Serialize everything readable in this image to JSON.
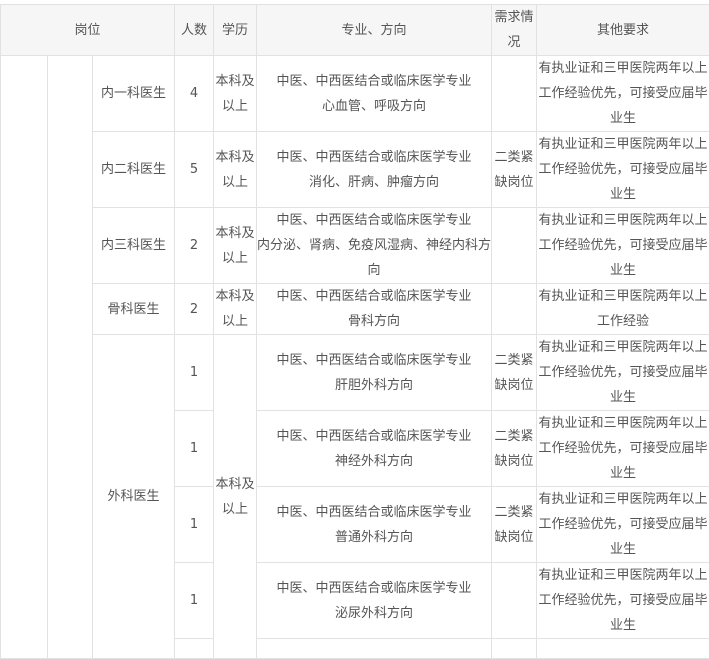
{
  "header": {
    "post": "岗位",
    "count": "人数",
    "education": "学历",
    "major": "专业、方向",
    "demand": "需求情况",
    "other": "其他要求"
  },
  "rows": [
    {
      "post": "内一科医生",
      "count": "4",
      "education": "本科及以上",
      "major_l1": "中医、中西医结合或临床医学专业",
      "major_l2": "心血管、呼吸方向",
      "demand": "",
      "other": "有执业证和三甲医院两年以上工作经验优先，可接受应届毕业生"
    },
    {
      "post": "内二科医生",
      "count": "5",
      "education": "本科及以上",
      "major_l1": "中医、中西医结合或临床医学专业",
      "major_l2": "消化、肝病、肿瘤方向",
      "demand": "二类紧缺岗位",
      "other": "有执业证和三甲医院两年以上工作经验优先，可接受应届毕业生"
    },
    {
      "post": "内三科医生",
      "count": "2",
      "education": "本科及以上",
      "major_l1": "中医、中西医结合或临床医学专业",
      "major_l2": "内分泌、肾病、免疫风湿病、神经内科方向",
      "demand": "",
      "other": "有执业证和三甲医院两年以上工作经验优先，可接受应届毕业生"
    },
    {
      "post": "骨科医生",
      "count": "2",
      "education": "本科及以上",
      "major_l1": "中医、中西医结合或临床医学专业",
      "major_l2": "骨科方向",
      "demand": "",
      "other": "有执业证和三甲医院两年以上工作经验"
    }
  ],
  "surgery": {
    "post": "外科医生",
    "education": "本科及以上",
    "rows": [
      {
        "count": "1",
        "major_l1": "中医、中西医结合或临床医学专业",
        "major_l2": "肝胆外科方向",
        "demand": "二类紧缺岗位",
        "other": "有执业证和三甲医院两年以上工作经验优先，可接受应届毕业生"
      },
      {
        "count": "1",
        "major_l1": "中医、中西医结合或临床医学专业",
        "major_l2": "神经外科方向",
        "demand": "二类紧缺岗位",
        "other": "有执业证和三甲医院两年以上工作经验优先，可接受应届毕业生"
      },
      {
        "count": "1",
        "major_l1": "中医、中西医结合或临床医学专业",
        "major_l2": "普通外科方向",
        "demand": "二类紧缺岗位",
        "other": "有执业证和三甲医院两年以上工作经验优先，可接受应届毕业生"
      },
      {
        "count": "1",
        "major_l1": "中医、中西医结合或临床医学专业",
        "major_l2": "泌尿外科方向",
        "demand": "",
        "other": "有执业证和三甲医院两年以上工作经验优先，可接受应届毕业生"
      }
    ]
  }
}
